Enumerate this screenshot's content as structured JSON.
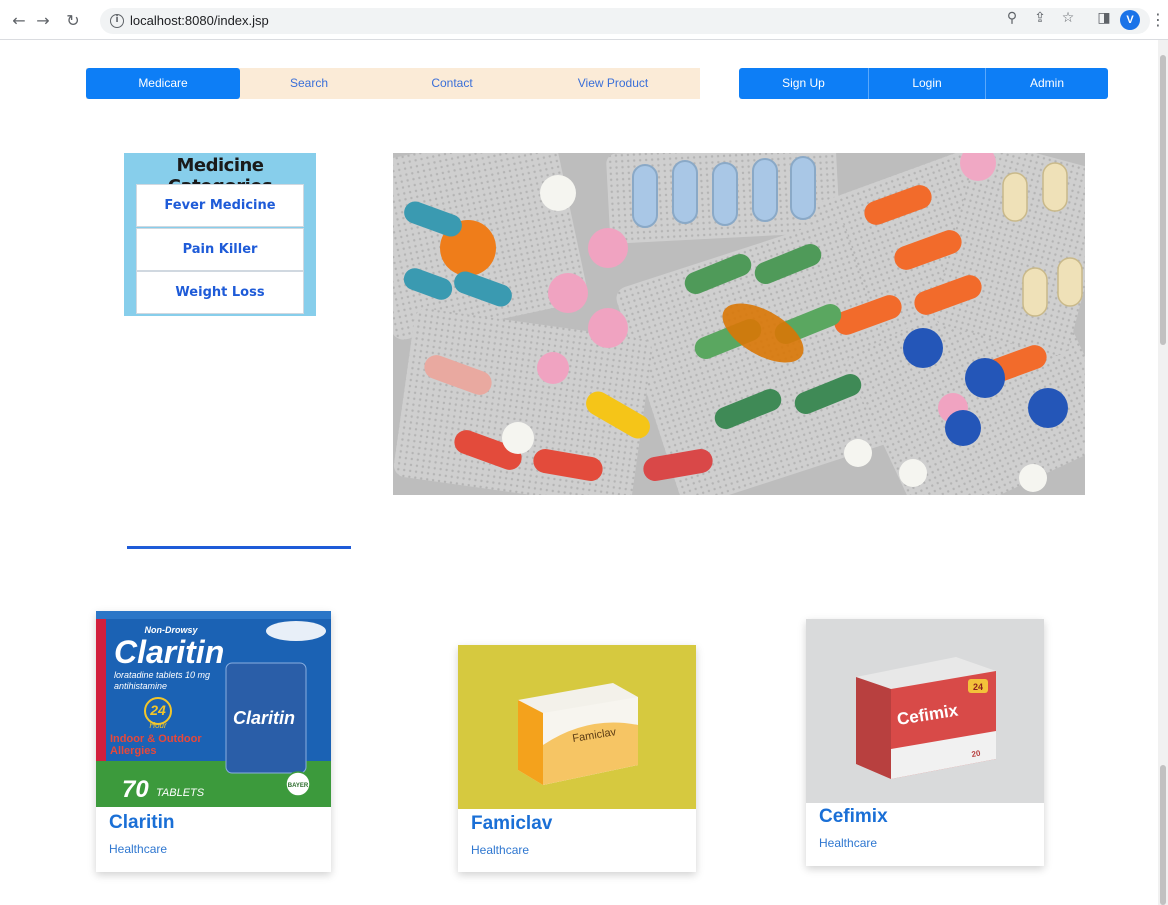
{
  "browser": {
    "url": "localhost:8080/index.jsp",
    "profile_initial": "V",
    "back_icon": "arrow-left-icon",
    "forward_icon": "arrow-right-icon",
    "reload_icon": "reload-icon"
  },
  "nav": {
    "brand": "Medicare",
    "links": [
      "Search",
      "Contact",
      "View Product"
    ],
    "auth": [
      "Sign Up",
      "Login",
      "Admin"
    ]
  },
  "categories": {
    "title": "Medicine Categories",
    "items": [
      "Fever Medicine",
      "Pain Killer",
      "Weight Loss"
    ]
  },
  "products": [
    {
      "name": "Claritin",
      "category": "Healthcare",
      "box_lines": [
        "Non-Drowsy",
        "Claritin",
        "loratadine tablets 10 mg",
        "antihistamine",
        "24",
        "Hour",
        "Indoor & Outdoor",
        "Allergies",
        "70",
        "TABLETS",
        "Claritin",
        "BAYER"
      ]
    },
    {
      "name": "Famiclav",
      "category": "Healthcare",
      "box_lines": [
        "Famiclav"
      ]
    },
    {
      "name": "Cefimix",
      "category": "Healthcare",
      "box_lines": [
        "Cefimix",
        "24",
        "20"
      ]
    }
  ],
  "colors": {
    "primary": "#0d7ef6",
    "nav_bg": "#fbebd7",
    "categories_bg": "#87ceeb",
    "link": "#1e5bd8"
  }
}
